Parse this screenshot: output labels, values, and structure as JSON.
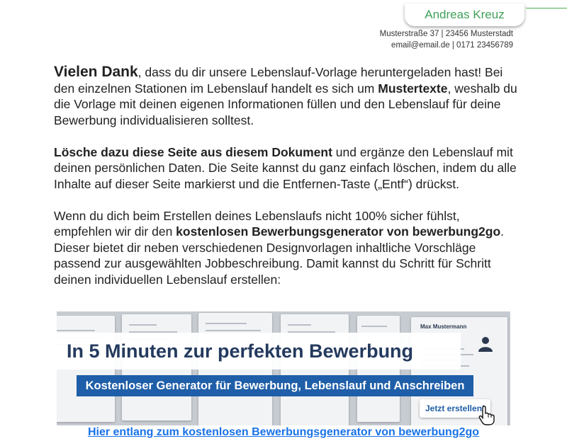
{
  "header": {
    "name": "Andreas Kreuz",
    "address_line": "Musterstraße 37  |  23456 Musterstadt",
    "contact_line": "email@email.de  |  0171 23456789",
    "accent_color": "#3fa25a"
  },
  "body": {
    "p1_lead": "Vielen Dank",
    "p1_a": ", dass du dir unsere Lebenslauf-Vorlage heruntergeladen hast! Bei den einzelnen Stationen im Lebenslauf handelt es sich um ",
    "p1_bold": "Mustertexte",
    "p1_b": ", weshalb du die Vorlage mit deinen eigenen Informationen füllen und den Lebenslauf für deine Bewerbung individualisieren solltest.",
    "p2_bold": "Lösche dazu diese Seite aus diesem Dokument",
    "p2_a": " und ergänze den Lebenslauf mit deinen persönlichen Daten. Die Seite kannst du ganz einfach löschen, indem du alle Inhalte auf dieser Seite markierst und die Entfernen-Taste („Entf“) drückst.",
    "p3_a": "Wenn du dich beim Erstellen deines Lebenslaufs nicht 100% sicher fühlst, empfehlen wir dir den ",
    "p3_bold": "kostenlosen Bewerbungsgenerator von bewerbung2go",
    "p3_b": ". Dieser bietet dir neben verschiedenen Designvorlagen inhaltliche Vorschläge passend zur ausgewählten Jobbeschreibung. Damit kannst du Schritt für Schritt deinen individuellen Lebenslauf erstellen:"
  },
  "banner": {
    "title": "In 5 Minuten zur perfekten Bewerbung",
    "subtitle": "Kostenloser Generator für Bewerbung, Lebenslauf und Anschreiben",
    "cta_label": "Jetzt erstellen!",
    "sample_name": "Max Mustermann",
    "brand_color": "#1f5ea8"
  },
  "link": {
    "text": "Hier entlang zum kostenlosen Bewerbungsgenerator von bewerbung2go"
  }
}
